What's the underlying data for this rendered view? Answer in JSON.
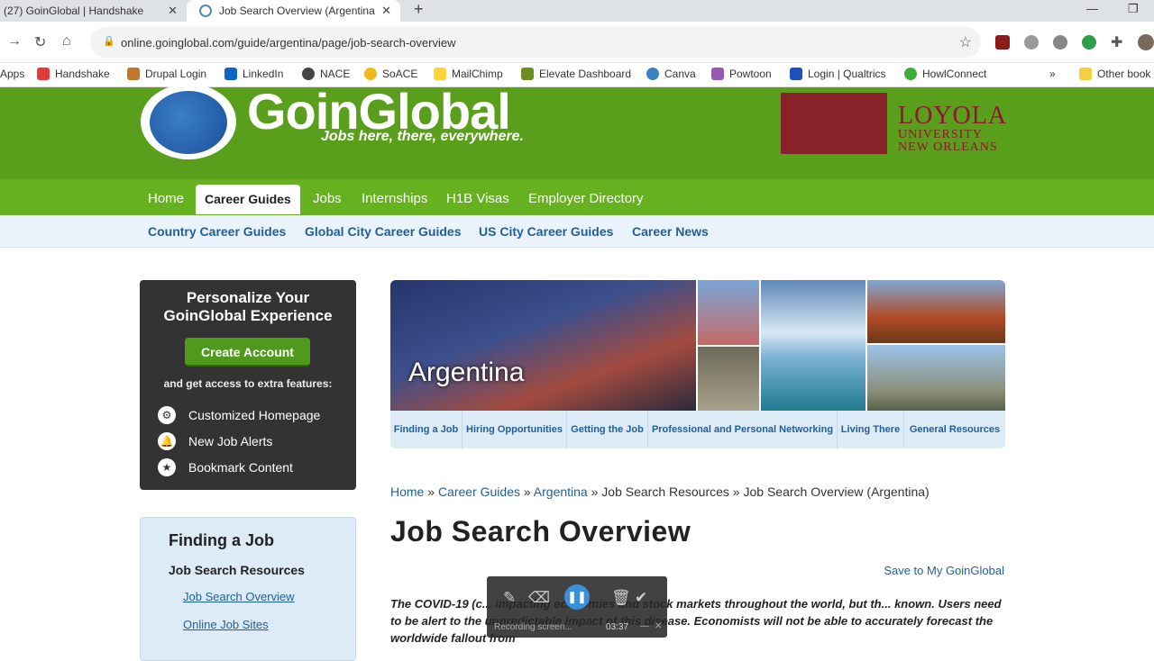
{
  "browser": {
    "tabs": [
      {
        "title": "(27) GoinGlobal | Handshake"
      },
      {
        "title": "Job Search Overview (Argentina"
      }
    ],
    "url": "online.goinglobal.com/guide/argentina/page/job-search-overview",
    "bookmarks": [
      {
        "label": "Apps",
        "color": ""
      },
      {
        "label": "Handshake",
        "color": "#e03a3a"
      },
      {
        "label": "Drupal Login",
        "color": "#c2762b"
      },
      {
        "label": "LinkedIn",
        "color": "#0a66c2"
      },
      {
        "label": "NACE",
        "color": "#444444"
      },
      {
        "label": "SoACE",
        "color": "#f0b81e"
      },
      {
        "label": "MailChimp",
        "color": "#ffd43b"
      },
      {
        "label": "Elevate Dashboard",
        "color": "#6b8e23"
      },
      {
        "label": "Canva",
        "color": "#3b82c4"
      },
      {
        "label": "Powtoon",
        "color": "#9b59b6"
      },
      {
        "label": "Login | Qualtrics",
        "color": "#1f4fbf"
      },
      {
        "label": "HowlConnect",
        "color": "#3cae3a"
      }
    ],
    "other_bookmarks": "Other book"
  },
  "site": {
    "logo": "GoinGlobal",
    "tagline": "Jobs here, there, everywhere.",
    "partner_line1": "LOYOLA",
    "partner_line2": "UNIVERSITY",
    "partner_line3": "NEW ORLEANS",
    "main_nav": [
      "Home",
      "Career Guides",
      "Jobs",
      "Internships",
      "H1B Visas",
      "Employer Directory"
    ],
    "sub_nav": [
      "Country Career Guides",
      "Global City Career Guides",
      "US City Career Guides",
      "Career News"
    ]
  },
  "promo": {
    "title_line1": "Personalize Your",
    "title_line2": "GoinGlobal Experience",
    "button": "Create Account",
    "intro": "and get access to extra features:",
    "features": [
      "Customized Homepage",
      "New Job Alerts",
      "Bookmark Content"
    ]
  },
  "sidebar": {
    "heading": "Finding a Job",
    "subheading": "Job Search Resources",
    "links": [
      "Job Search Overview",
      "Online Job Sites"
    ]
  },
  "hero": {
    "title": "Argentina",
    "tabs": [
      "Finding a Job",
      "Hiring Opportunities",
      "Getting the Job",
      "Professional and Personal Networking",
      "Living There",
      "General Resources"
    ]
  },
  "breadcrumb": {
    "items": [
      "Home",
      "Career Guides",
      "Argentina"
    ],
    "rest": "» Job Search Resources » Job Search Overview (Argentina)"
  },
  "page": {
    "title": "Job Search Overview",
    "save": "Save to My GoinGlobal",
    "body": "The COVID-19 (c... impacting economies and stock markets throughout the world, but th... known. Users need to be alert to the unpredictable impact of this disease. Economists will not be able to accurately forecast the worldwide fallout from"
  },
  "recorder": {
    "status": "Recording screen...",
    "time": "03:37"
  }
}
